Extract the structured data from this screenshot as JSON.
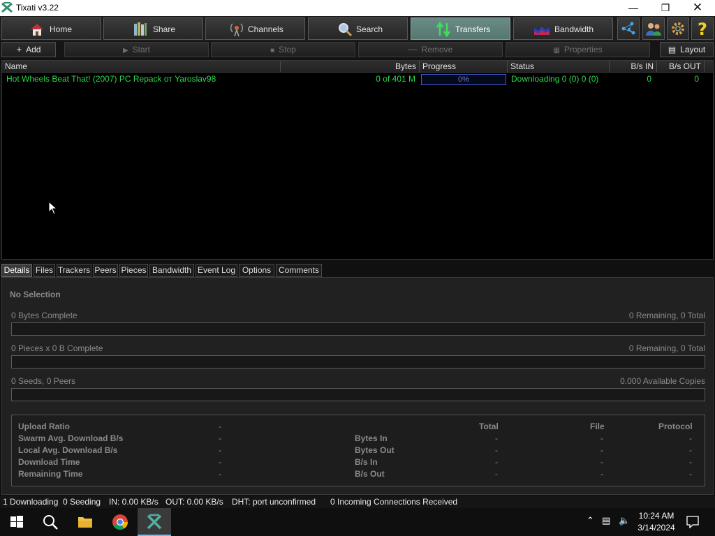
{
  "window": {
    "title": "Tixati v3.22"
  },
  "nav": {
    "home": "Home",
    "share": "Share",
    "channels": "Channels",
    "search": "Search",
    "transfers": "Transfers",
    "bandwidth": "Bandwidth",
    "active": "transfers"
  },
  "toolbar": {
    "add": "Add",
    "start": "Start",
    "stop": "Stop",
    "remove": "Remove",
    "properties": "Properties",
    "layout": "Layout"
  },
  "list": {
    "columns": [
      "Name",
      "Bytes",
      "Progress",
      "Status",
      "B/s IN",
      "B/s OUT"
    ],
    "rows": [
      {
        "name": "Hot Wheels Beat That! (2007) PC  Repack от Yaroslav98",
        "bytes": "0 of 401 M",
        "progress": "0%",
        "status": "Downloading 0 (0) 0 (0)",
        "bs_in": "0",
        "bs_out": "0"
      }
    ]
  },
  "tabs": [
    "Details",
    "Files",
    "Trackers",
    "Peers",
    "Pieces",
    "Bandwidth",
    "Event Log",
    "Options",
    "Comments"
  ],
  "details": {
    "selection": "No Selection",
    "bytes_complete": "0 Bytes Complete",
    "bytes_remaining": "0 Remaining,  0 Total",
    "pieces_complete": "0 Pieces  x  0 B Complete",
    "pieces_remaining": "0 Remaining,  0 Total",
    "seeds_peers": "0 Seeds, 0 Peers",
    "available_copies": "0.000 Available Copies",
    "stats_left": [
      {
        "label": "Upload Ratio",
        "value": "-"
      },
      {
        "label": "Swarm Avg. Download B/s",
        "value": "-"
      },
      {
        "label": "Local Avg. Download B/s",
        "value": "-"
      },
      {
        "label": "Download Time",
        "value": "-"
      },
      {
        "label": "Remaining Time",
        "value": "-"
      }
    ],
    "stats_headers": [
      "Total",
      "File",
      "Protocol"
    ],
    "stats_right": [
      {
        "label": "Bytes In",
        "total": "-",
        "file": "-",
        "protocol": "-"
      },
      {
        "label": "Bytes Out",
        "total": "-",
        "file": "-",
        "protocol": "-"
      },
      {
        "label": "B/s In",
        "total": "-",
        "file": "-",
        "protocol": "-"
      },
      {
        "label": "B/s Out",
        "total": "-",
        "file": "-",
        "protocol": "-"
      }
    ]
  },
  "statusbar": {
    "downloading": "1 Downloading",
    "seeding": "0 Seeding",
    "in": "IN: 0.00 KB/s",
    "out": "OUT: 0.00 KB/s",
    "dht": "DHT: port unconfirmed",
    "incoming": "0 Incoming Connections Received"
  },
  "taskbar": {
    "time": "10:24 AM",
    "date": "3/14/2024",
    "apps": [
      "start-icon",
      "search-icon",
      "file-explorer-icon",
      "chrome-icon",
      "tixati-icon"
    ]
  },
  "colors": {
    "accent_active_nav": "#5f807b",
    "row_text": "#2ad94a",
    "progress_border": "#3f5fd0"
  }
}
